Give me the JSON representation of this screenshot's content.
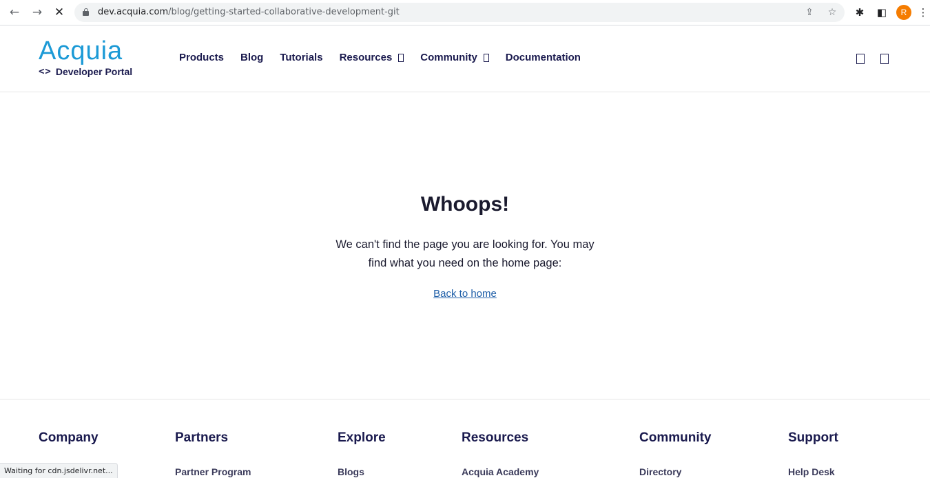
{
  "browser": {
    "back_icon": "←",
    "forward_icon": "→",
    "stop_icon": "✕",
    "url_host": "dev.acquia.com",
    "url_path": "/blog/getting-started-collaborative-development-git",
    "share_icon": "⇪",
    "star_icon": "☆",
    "extensions_icon": "✱",
    "sidepanel_icon": "◧",
    "profile_initial": "R",
    "menu_icon": "⋮",
    "status_text": "Waiting for cdn.jsdelivr.net..."
  },
  "header": {
    "logo_word": "Acquia",
    "logo_code": "<>",
    "logo_sub": "Developer Portal",
    "nav": [
      {
        "label": "Products"
      },
      {
        "label": "Blog"
      },
      {
        "label": "Tutorials"
      },
      {
        "label": "Resources"
      },
      {
        "label": "Community"
      },
      {
        "label": "Documentation"
      }
    ]
  },
  "main": {
    "title": "Whoops!",
    "message": "We can't find the page you are looking for. You may find what you need on the home page:",
    "link": "Back to home"
  },
  "footer": {
    "columns": [
      {
        "heading": "Company",
        "link": ""
      },
      {
        "heading": "Partners",
        "link": "Partner Program"
      },
      {
        "heading": "Explore",
        "link": "Blogs"
      },
      {
        "heading": "Resources",
        "link": "Acquia Academy"
      },
      {
        "heading": "Community",
        "link": "Directory"
      },
      {
        "heading": "Support",
        "link": "Help Desk"
      }
    ]
  },
  "colors": {
    "brand": "#1c9ad6",
    "navy": "#1a1a4e",
    "link": "#1f5fa8",
    "profile": "#f57c00"
  }
}
